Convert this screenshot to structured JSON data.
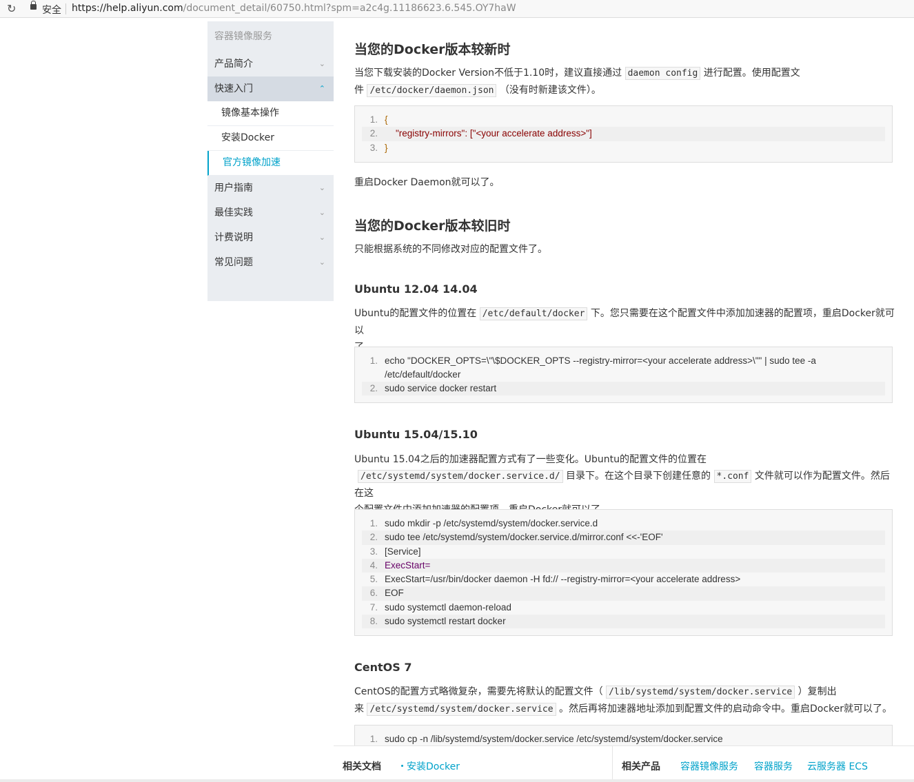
{
  "browser": {
    "secure_label": "安全",
    "url_host": "https://help.aliyun.com",
    "url_path": "/document_detail/60750.html?spm=a2c4g.11186623.6.545.OY7haW"
  },
  "sidebar": {
    "title": "容器镜像服务",
    "items": [
      {
        "label": "产品简介"
      },
      {
        "label": "快速入门"
      },
      {
        "label": "用户指南"
      },
      {
        "label": "最佳实践"
      },
      {
        "label": "计费说明"
      },
      {
        "label": "常见问题"
      }
    ],
    "sub_items": [
      {
        "label": "镜像基本操作"
      },
      {
        "label": "安装Docker"
      },
      {
        "label": "官方镜像加速"
      }
    ]
  },
  "content": {
    "h_new": "当您的Docker版本较新时",
    "p_new_1a": "当您下载安装的Docker Version不低于1.10时，建议直接通过",
    "p_new_code1": "daemon config",
    "p_new_1b": "进行配置。使用配置文",
    "p_new_2a": "件",
    "p_new_code2": "/etc/docker/daemon.json",
    "p_new_2b": "（没有时新建该文件）。",
    "code1": [
      "{",
      "\"registry-mirrors\": [\"<your accelerate address>\"]",
      "}"
    ],
    "p_restart": "重启Docker Daemon就可以了。",
    "h_old": "当您的Docker版本较旧时",
    "p_old": "只能根据系统的不同修改对应的配置文件了。",
    "h_u1204": "Ubuntu 12.04 14.04",
    "p_u1204_a": "Ubuntu的配置文件的位置在",
    "p_u1204_code": "/etc/default/docker",
    "p_u1204_b": "下。您只需要在这个配置文件中添加加速器的配置项，重启Docker就可以",
    "p_u1204_c": "了。",
    "code2": [
      "echo \"DOCKER_OPTS=\\\"\\$DOCKER_OPTS --registry-mirror=<your accelerate address>\\\"\" | sudo tee -a /etc/default/docker",
      "sudo service docker restart"
    ],
    "h_u1504": "Ubuntu 15.04/15.10",
    "p_u1504_a": "Ubuntu 15.04之后的加速器配置方式有了一些变化。Ubuntu的配置文件的位置在",
    "p_u1504_code1": "/etc/systemd/system/docker.service.d/",
    "p_u1504_b": "目录下。在这个目录下创建任意的",
    "p_u1504_code2": "*.conf",
    "p_u1504_c": "文件就可以作为配置文件。然后在这",
    "p_u1504_d": "个配置文件中添加加速器的配置项，重启Docker就可以了。",
    "code3": [
      "sudo mkdir -p /etc/systemd/system/docker.service.d",
      "sudo tee /etc/systemd/system/docker.service.d/mirror.conf <<-'EOF'",
      "[Service]",
      "ExecStart=",
      "ExecStart=/usr/bin/docker daemon -H fd:// --registry-mirror=<your accelerate address>",
      "EOF",
      "sudo systemctl daemon-reload",
      "sudo systemctl restart docker"
    ],
    "h_centos": "CentOS 7",
    "p_centos_a": "CentOS的配置方式略微复杂，需要先将默认的配置文件（",
    "p_centos_code1": "/lib/systemd/system/docker.service",
    "p_centos_b": "）复制出",
    "p_centos_c": "来",
    "p_centos_code2": "/etc/systemd/system/docker.service",
    "p_centos_d": "。然后再将加速器地址添加到配置文件的启动命令中。重启Docker就可以了。",
    "code4": [
      "sudo cp -n /lib/systemd/system/docker.service /etc/systemd/system/docker.service"
    ]
  },
  "footer": {
    "related_docs_label": "相关文档",
    "related_doc_link": "安装Docker",
    "related_products_label": "相关产品",
    "products": [
      "容器镜像服务",
      "容器服务",
      "云服务器 ECS"
    ]
  }
}
